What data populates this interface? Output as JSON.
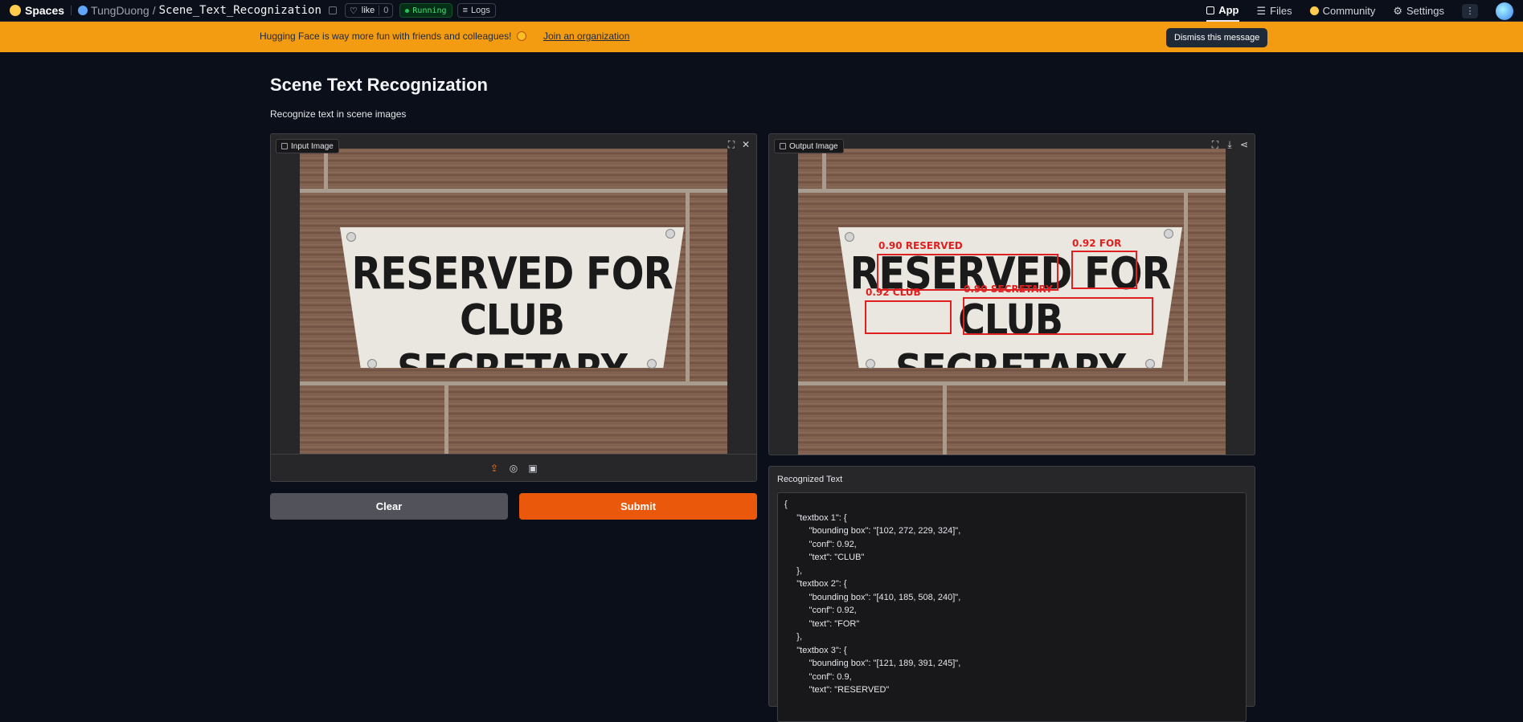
{
  "nav": {
    "brand": "Spaces",
    "owner": "TungDuong",
    "slash": "/",
    "space_name": "Scene_Text_Recognization",
    "like_label": "like",
    "like_count": "0",
    "status": "Running",
    "logs_label": "Logs",
    "tabs": [
      "App",
      "Files",
      "Community",
      "Settings"
    ],
    "kebab": "⋮"
  },
  "banner": {
    "message": "Hugging Face is way more fun with friends and colleagues!",
    "link": "Join an organization",
    "dismiss": "Dismiss this message"
  },
  "page": {
    "title": "Scene Text Recognization",
    "description": "Recognize text in scene images"
  },
  "input_panel": {
    "label": "Input Image"
  },
  "output_panel": {
    "label": "Output Image"
  },
  "sign": {
    "line1": "RESERVED FOR",
    "line2": "CLUB SECRETARY"
  },
  "detections": [
    {
      "label": "0.90 RESERVED",
      "word": "RESERVED"
    },
    {
      "label": "0.92 FOR",
      "word": "FOR"
    },
    {
      "label": "0.92 CLUB",
      "word": "CLUB"
    },
    {
      "label": "0.90 SECRETARY",
      "word": "SECRETARY"
    }
  ],
  "buttons": {
    "clear": "Clear",
    "submit": "Submit"
  },
  "recognized": {
    "label": "Recognized Text",
    "json_text": "{\n     \"textbox 1\": {\n          \"bounding box\": \"[102, 272, 229, 324]\",\n          \"conf\": 0.92,\n          \"text\": \"CLUB\"\n     },\n     \"textbox 2\": {\n          \"bounding box\": \"[410, 185, 508, 240]\",\n          \"conf\": 0.92,\n          \"text\": \"FOR\"\n     },\n     \"textbox 3\": {\n          \"bounding box\": \"[121, 189, 391, 245]\",\n          \"conf\": 0.9,\n          \"text\": \"RESERVED\""
  },
  "colors": {
    "accent": "#ea580c",
    "banner": "#f39c12",
    "bbox": "#e02020",
    "running": "#4ade80"
  }
}
